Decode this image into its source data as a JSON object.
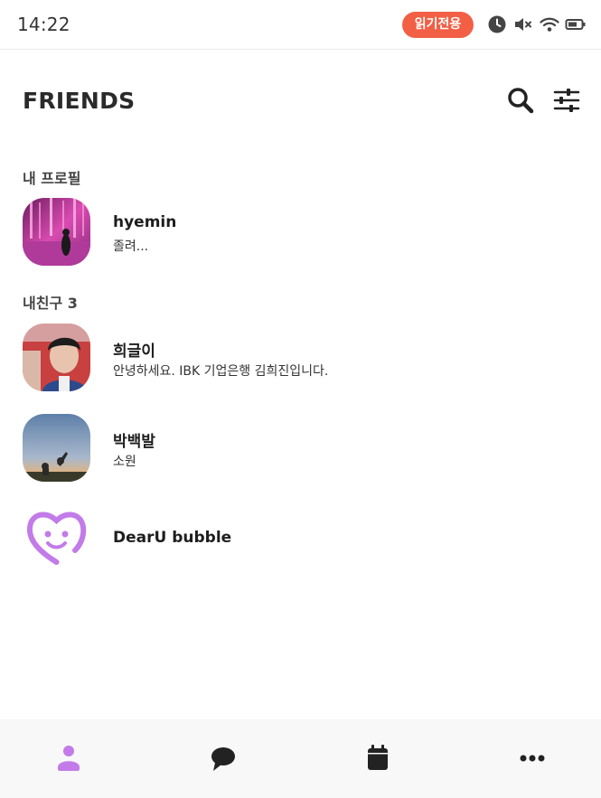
{
  "status_bar": {
    "time": "14:22",
    "badge": "읽기전용",
    "icons": [
      "clock-icon",
      "mute-icon",
      "wifi-icon",
      "battery-icon"
    ]
  },
  "header": {
    "title": "FRIENDS",
    "search_icon": "search-icon",
    "settings_icon": "sliders-icon"
  },
  "my_profile": {
    "section_label": "내 프로필",
    "name": "hyemin",
    "status": "졸려..."
  },
  "friends": {
    "section_label": "내친구 3",
    "items": [
      {
        "name": "희글이",
        "status": "안녕하세요. IBK 기업은행 김희진입니다."
      },
      {
        "name": "박백발",
        "status": "소원"
      }
    ]
  },
  "bubble": {
    "name": "DearU bubble"
  },
  "bottom_nav": {
    "items": [
      "friends-icon",
      "chat-icon",
      "calendar-icon",
      "more-icon"
    ],
    "active": "friends-icon"
  },
  "colors": {
    "badge": "#f25f45",
    "accent": "#c27be8",
    "text": "#222222"
  }
}
